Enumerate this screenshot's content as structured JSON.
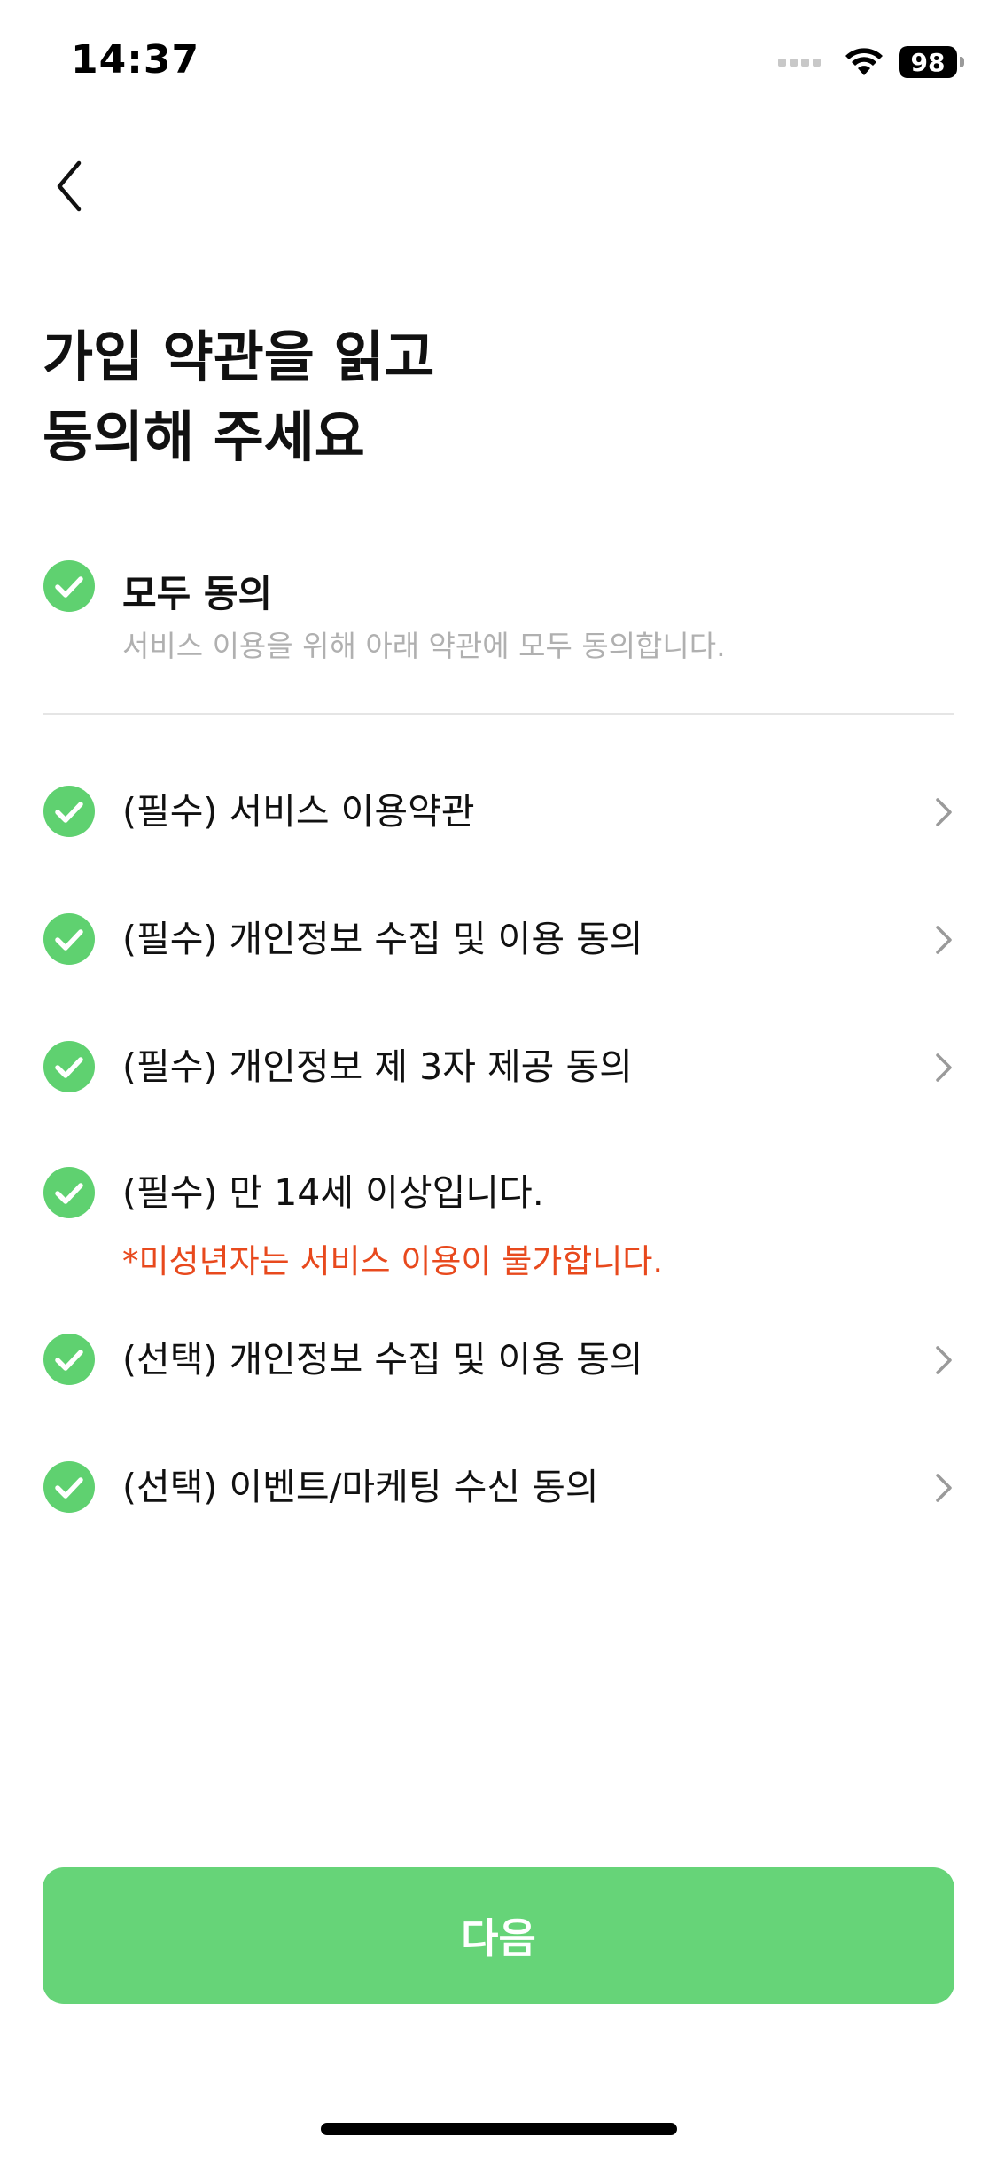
{
  "status_bar": {
    "time": "14:37",
    "battery": "98",
    "icons": [
      "signal-icon",
      "wifi-icon",
      "battery-icon"
    ]
  },
  "header": {
    "back_icon": "chevron-left-icon"
  },
  "title": {
    "line1": "가입 약관을 읽고",
    "line2": "동의해 주세요"
  },
  "all_agree": {
    "label": "모두 동의",
    "description": "서비스 이용을 위해 아래 약관에 모두 동의합니다.",
    "checked": true
  },
  "terms": [
    {
      "label": "(필수) 서비스 이용약관",
      "checked": true,
      "has_detail": true
    },
    {
      "label": "(필수) 개인정보 수집 및 이용 동의",
      "checked": true,
      "has_detail": true
    },
    {
      "label": "(필수) 개인정보 제 3자 제공 동의",
      "checked": true,
      "has_detail": true
    },
    {
      "label": "(필수) 만 14세 이상입니다.",
      "warning": "*미성년자는 서비스 이용이 불가합니다.",
      "checked": true,
      "has_detail": false
    },
    {
      "label": "(선택) 개인정보 수집 및 이용 동의",
      "checked": true,
      "has_detail": true
    },
    {
      "label": "(선택) 이벤트/마케팅 수신 동의",
      "checked": true,
      "has_detail": true
    }
  ],
  "next_button": {
    "label": "다음"
  },
  "colors": {
    "accent_green": "#66d478",
    "check_green": "#5fd170",
    "warning_orange": "#e8491d",
    "muted_text": "#b0b0b0"
  }
}
